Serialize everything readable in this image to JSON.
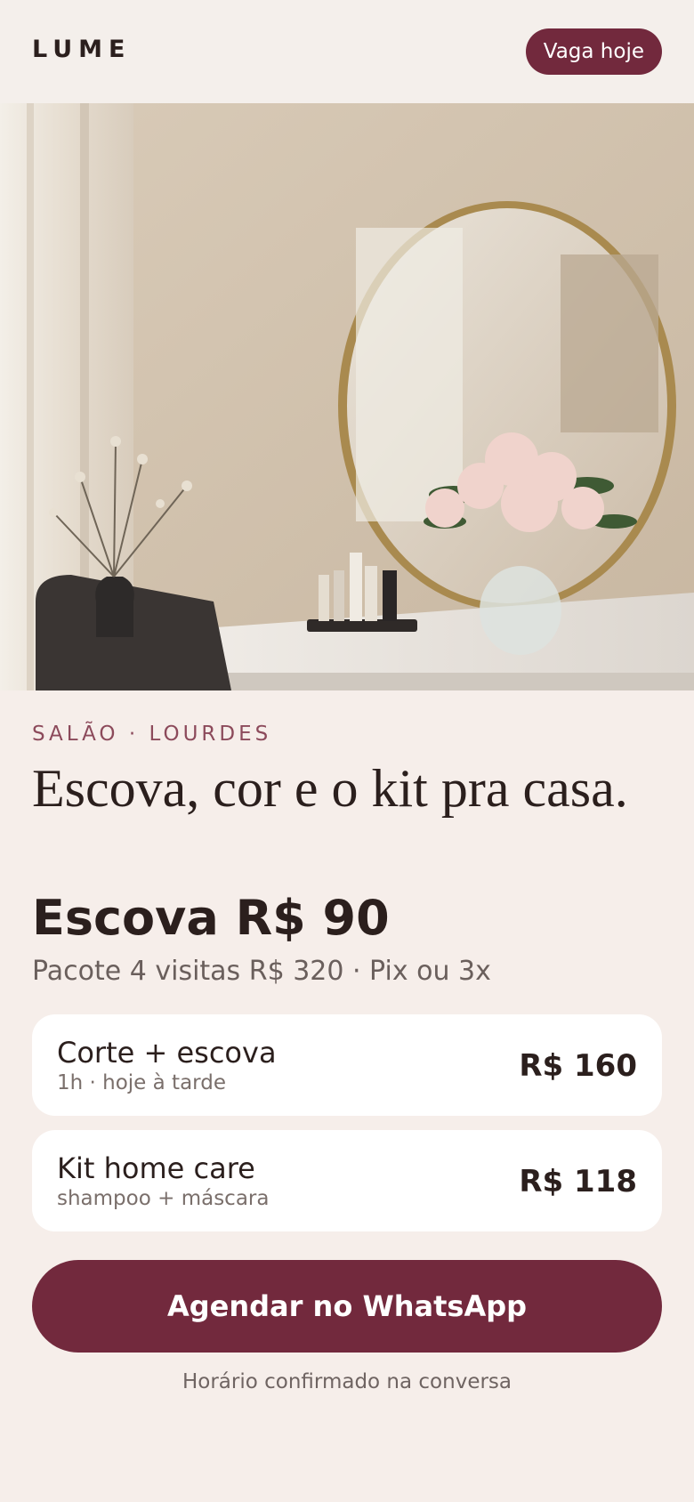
{
  "header": {
    "logo": "LUME",
    "cta_label": "Vaga hoje"
  },
  "hero": {
    "image": "salon-vanity-with-round-mirror-and-peonies"
  },
  "intro": {
    "eyebrow": "SALÃO · LOURDES",
    "headline": "Escova, cor e o kit pra casa.",
    "price": "Escova R$ 90",
    "subprice": "Pacote 4 visitas R$ 320 · Pix ou 3x"
  },
  "services": [
    {
      "name": "Corte + escova",
      "detail": "1h · hoje à tarde",
      "price": "R$ 160"
    },
    {
      "name": "Kit home care",
      "detail": "shampoo + máscara",
      "price": "R$ 118"
    }
  ],
  "cta": {
    "label": "Agendar no WhatsApp",
    "note": "Horário confirmado na conversa"
  },
  "colors": {
    "accent": "#72293d",
    "background": "#f6eeea",
    "eyebrow": "#8c4a5b"
  }
}
